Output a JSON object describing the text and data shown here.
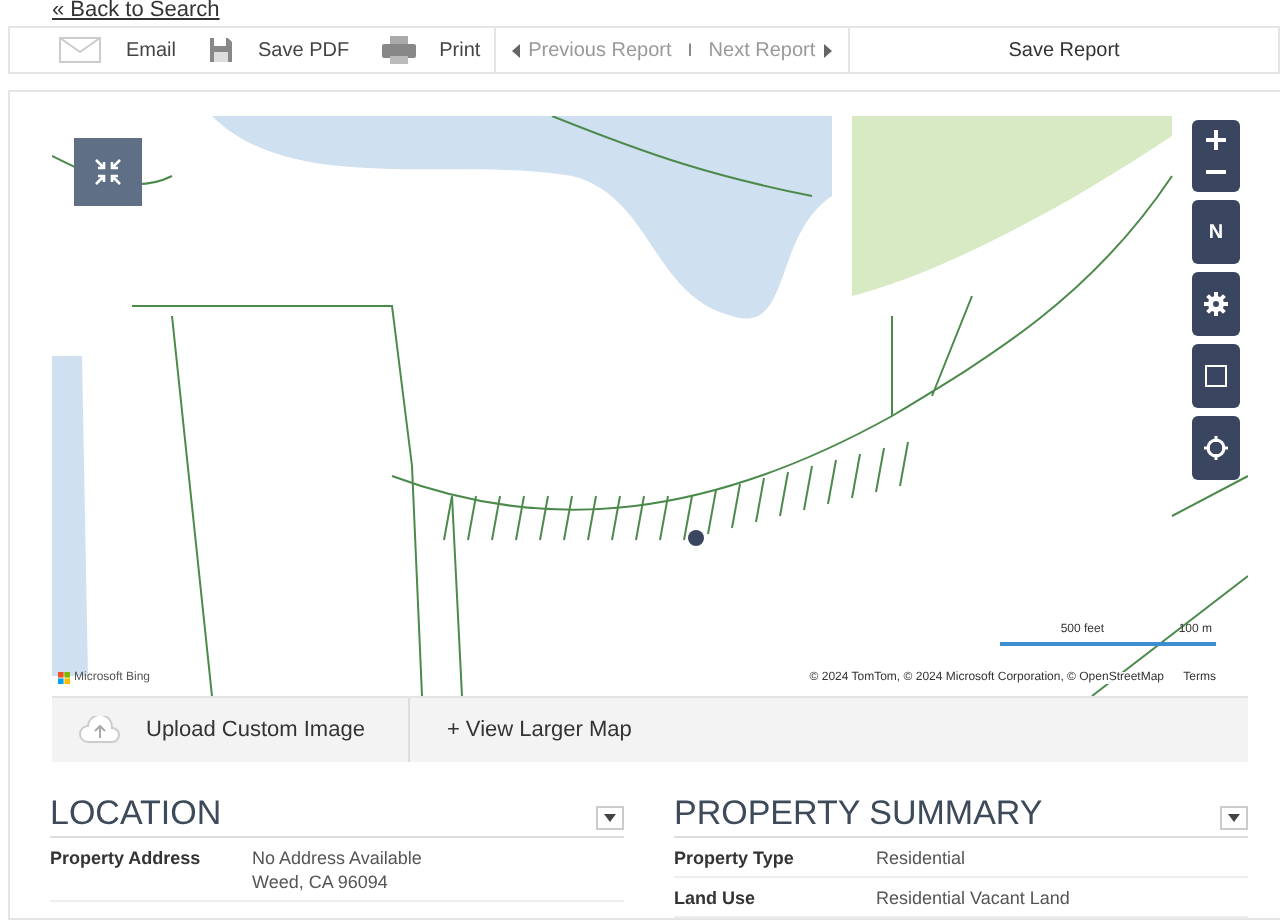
{
  "back_link": "« Back to Search",
  "toolbar": {
    "actions": [
      {
        "kind": "email",
        "label": "Email"
      },
      {
        "kind": "pdf",
        "label": "Save PDF"
      },
      {
        "kind": "print",
        "label": "Print"
      }
    ],
    "nav": [
      {
        "kind": "prev",
        "label": "Previous Report",
        "disabled": true
      },
      {
        "kind": "next",
        "label": "Next Report",
        "disabled": true
      }
    ],
    "separator": "I",
    "save": "Save Report"
  },
  "map": {
    "controls": [
      {
        "kind": "zoom"
      },
      {
        "kind": "compass",
        "label": "N"
      },
      {
        "kind": "settings"
      },
      {
        "kind": "select"
      },
      {
        "kind": "locate"
      }
    ],
    "brand": "Microsoft Bing",
    "scale": [
      "500 feet",
      "100 m"
    ],
    "copyright": "© 2024 TomTom, © 2024 Microsoft Corporation, © OpenStreetMap",
    "terms": "Terms"
  },
  "map_bar": {
    "upload": "Upload Custom Image",
    "larger": "+ View Larger Map"
  },
  "sections": [
    {
      "title": "LOCATION",
      "rows": [
        {
          "label": "Property Address",
          "values": [
            "No Address Available",
            "Weed, CA 96094"
          ]
        }
      ]
    },
    {
      "title": "PROPERTY SUMMARY",
      "rows": [
        {
          "label": "Property Type",
          "values": [
            "Residential"
          ]
        },
        {
          "label": "Land Use",
          "values": [
            "Residential Vacant Land"
          ]
        }
      ]
    }
  ]
}
